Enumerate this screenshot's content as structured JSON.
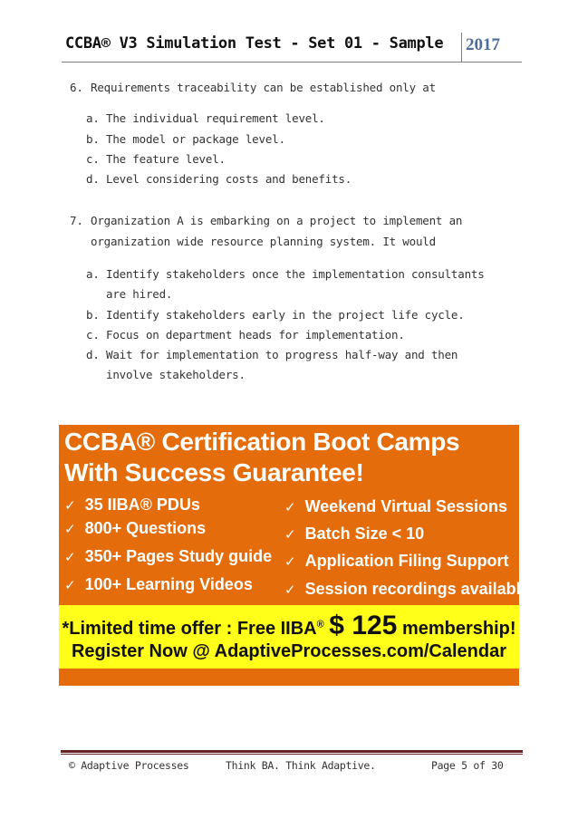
{
  "header": {
    "title": "CCBA® V3 Simulation Test  -  Set 01 - Sample",
    "year": "2017"
  },
  "questions": [
    {
      "number": "6.",
      "text_lines": [
        "Requirements traceability can be established only at"
      ],
      "options": [
        {
          "letter": "a.",
          "lines": [
            "The individual requirement level."
          ]
        },
        {
          "letter": "b.",
          "lines": [
            "The model or package level."
          ]
        },
        {
          "letter": "c.",
          "lines": [
            "The feature level."
          ]
        },
        {
          "letter": "d.",
          "lines": [
            "Level considering costs and benefits."
          ]
        }
      ]
    },
    {
      "number": "7.",
      "text_lines": [
        "Organization A is embarking on a project to implement an",
        "organization wide resource planning system. It would"
      ],
      "options": [
        {
          "letter": "a.",
          "lines": [
            "Identify stakeholders once the implementation consultants",
            "are hired."
          ]
        },
        {
          "letter": "b.",
          "lines": [
            "Identify stakeholders early in the project life cycle."
          ]
        },
        {
          "letter": "c.",
          "lines": [
            "Focus on department heads for implementation."
          ]
        },
        {
          "letter": "d.",
          "lines": [
            "Wait for implementation to progress half-way and then",
            "involve stakeholders."
          ]
        }
      ]
    }
  ],
  "banner": {
    "title_line1": "CCBA® Certification Boot Camps",
    "title_line2": "With Success Guarantee!",
    "check_icon": "✓",
    "features_left": [
      "35 IIBA® PDUs",
      "800+ Questions",
      "350+ Pages Study guide",
      "100+ Learning Videos"
    ],
    "features_right": [
      "Weekend Virtual Sessions",
      "Batch Size < 10",
      "Application Filing Support",
      "Session recordings available"
    ],
    "offer_prefix": "*Limited time offer : Free IIBA",
    "offer_reg": "®",
    "offer_amount": "$ 125",
    "offer_suffix": "membership!",
    "register_line": "Register Now @ AdaptiveProcesses.com/Calendar",
    "colors": {
      "background": "#e46c0a",
      "offer_strip": "#ffff1a"
    }
  },
  "footer": {
    "left": "© Adaptive Processes",
    "center": "Think BA. Think Adaptive.",
    "right": "Page 5 of 30",
    "rule_color": "#622423"
  }
}
